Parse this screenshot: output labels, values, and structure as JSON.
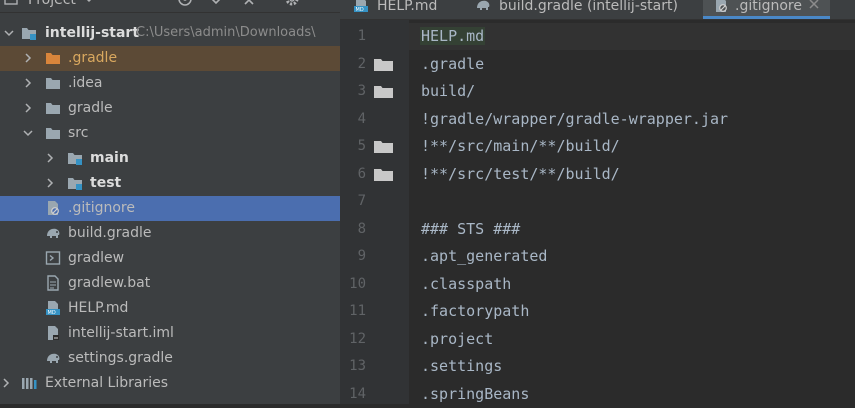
{
  "project_panel": {
    "title": "Project",
    "root": {
      "name": "intellij-start",
      "path": "C:\\Users\\admin\\Downloads\\"
    },
    "items": [
      {
        "label": ".gradle",
        "icon": "folder-orange-icon"
      },
      {
        "label": ".idea",
        "icon": "folder-icon"
      },
      {
        "label": "gradle",
        "icon": "folder-icon"
      },
      {
        "label": "src",
        "icon": "folder-icon"
      },
      {
        "label": "main",
        "icon": "module-folder-icon"
      },
      {
        "label": "test",
        "icon": "module-folder-icon"
      },
      {
        "label": ".gitignore",
        "icon": "gitignore-file-icon"
      },
      {
        "label": "build.gradle",
        "icon": "gradle-elephant-icon"
      },
      {
        "label": "gradlew",
        "icon": "terminal-file-icon"
      },
      {
        "label": "gradlew.bat",
        "icon": "text-file-icon"
      },
      {
        "label": "HELP.md",
        "icon": "markdown-file-icon"
      },
      {
        "label": "intellij-start.iml",
        "icon": "iml-file-icon"
      },
      {
        "label": "settings.gradle",
        "icon": "gradle-elephant-icon"
      },
      {
        "label": "External Libraries",
        "icon": "libraries-icon"
      }
    ]
  },
  "tabs": [
    {
      "label": "HELP.md",
      "icon": "markdown-file-icon"
    },
    {
      "label": "build.gradle (intellij-start)",
      "icon": "gradle-elephant-icon"
    },
    {
      "label": ".gitignore",
      "icon": "gitignore-file-icon",
      "active": true
    }
  ],
  "editor": {
    "lines": [
      {
        "n": "1",
        "text": "HELP.md"
      },
      {
        "n": "2",
        "text": ".gradle"
      },
      {
        "n": "3",
        "text": "build/"
      },
      {
        "n": "4",
        "text": "!gradle/wrapper/gradle-wrapper.jar"
      },
      {
        "n": "5",
        "text": "!**/src/main/**/build/"
      },
      {
        "n": "6",
        "text": "!**/src/test/**/build/"
      },
      {
        "n": "7",
        "text": ""
      },
      {
        "n": "8",
        "text": "### STS ###"
      },
      {
        "n": "9",
        "text": ".apt_generated"
      },
      {
        "n": "10",
        "text": ".classpath"
      },
      {
        "n": "11",
        "text": ".factorypath"
      },
      {
        "n": "12",
        "text": ".project"
      },
      {
        "n": "13",
        "text": ".settings"
      },
      {
        "n": "14",
        "text": ".springBeans"
      }
    ]
  },
  "colors": {
    "selection": "#4b6eaf",
    "tab_accent": "#4a88c7",
    "text": "#a9b7c6"
  }
}
